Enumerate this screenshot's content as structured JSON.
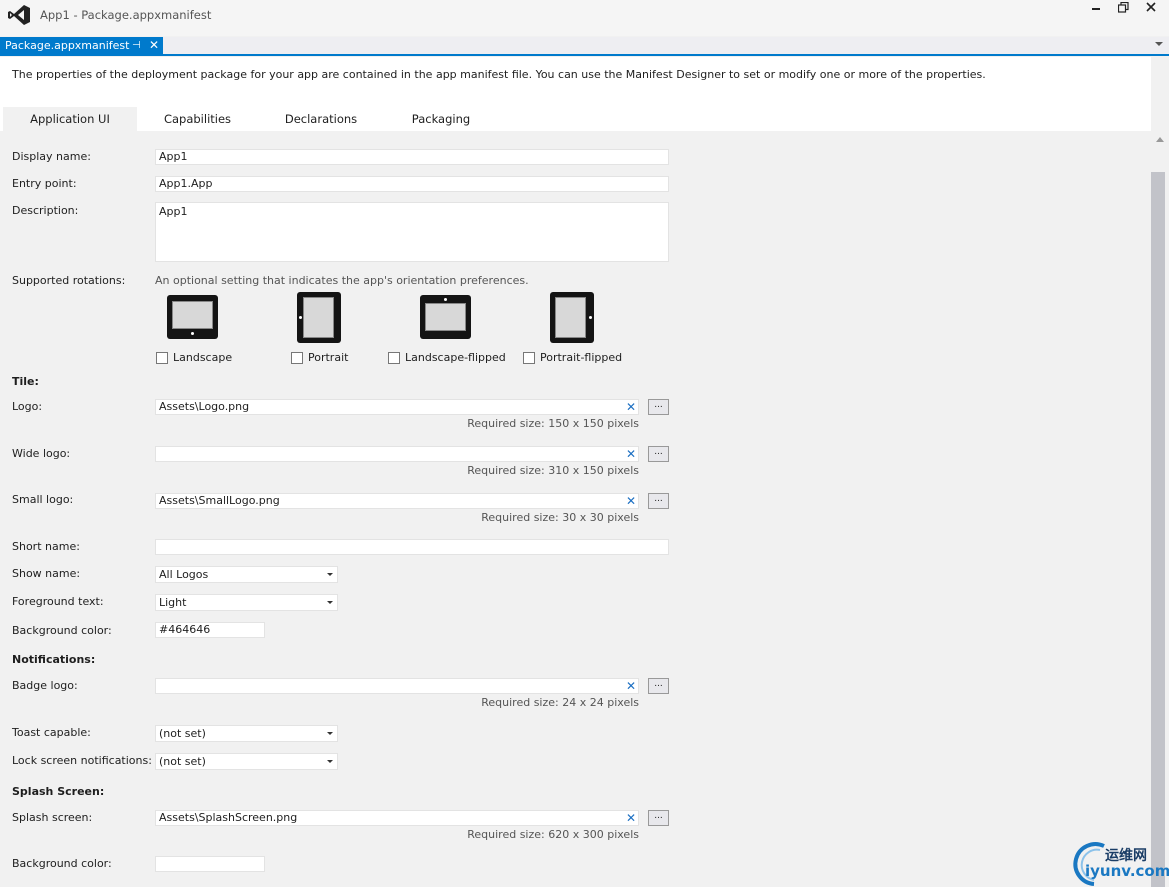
{
  "window": {
    "title": "App1 - Package.appxmanifest"
  },
  "doc_tab": {
    "label": "Package.appxmanifest",
    "pin_glyph": "⊣",
    "close_glyph": "✕"
  },
  "description": "The properties of the deployment package for your app are contained in the app manifest file. You can use the Manifest Designer to set or modify one or more of the properties.",
  "tabs": [
    "Application UI",
    "Capabilities",
    "Declarations",
    "Packaging"
  ],
  "form": {
    "display_name_label": "Display name:",
    "display_name_value": "App1",
    "entry_point_label": "Entry point:",
    "entry_point_value": "App1.App",
    "description_label": "Description:",
    "description_value": "App1",
    "rotations_label": "Supported rotations:",
    "rotations_hint": "An optional setting that indicates the app's orientation preferences.",
    "rotations": [
      "Landscape",
      "Portrait",
      "Landscape-flipped",
      "Portrait-flipped"
    ],
    "tile_section": "Tile:",
    "logo_label": "Logo:",
    "logo_value": "Assets\\Logo.png",
    "logo_req": "Required size: 150 x 150 pixels",
    "wide_logo_label": "Wide logo:",
    "wide_logo_value": "",
    "wide_logo_req": "Required size: 310 x 150 pixels",
    "small_logo_label": "Small logo:",
    "small_logo_value": "Assets\\SmallLogo.png",
    "small_logo_req": "Required size: 30 x 30 pixels",
    "short_name_label": "Short name:",
    "short_name_value": "",
    "show_name_label": "Show name:",
    "show_name_value": "All Logos",
    "foreground_label": "Foreground text:",
    "foreground_value": "Light",
    "bg_color_label": "Background color:",
    "bg_color_value": "#464646",
    "notifications_section": "Notifications:",
    "badge_logo_label": "Badge logo:",
    "badge_logo_value": "",
    "badge_logo_req": "Required size: 24 x 24 pixels",
    "toast_label": "Toast capable:",
    "toast_value": "(not set)",
    "lock_label": "Lock screen notifications:",
    "lock_value": "(not set)",
    "splash_section": "Splash Screen:",
    "splash_label": "Splash screen:",
    "splash_value": "Assets\\SplashScreen.png",
    "splash_req": "Required size: 620 x 300 pixels",
    "splash_bg_label": "Background color:",
    "splash_bg_value": "",
    "clear_glyph": "✕",
    "browse_glyph": "..."
  },
  "watermark": {
    "cn": "运维网",
    "url": "iyunv.com"
  },
  "colors": {
    "accent": "#007acc"
  }
}
